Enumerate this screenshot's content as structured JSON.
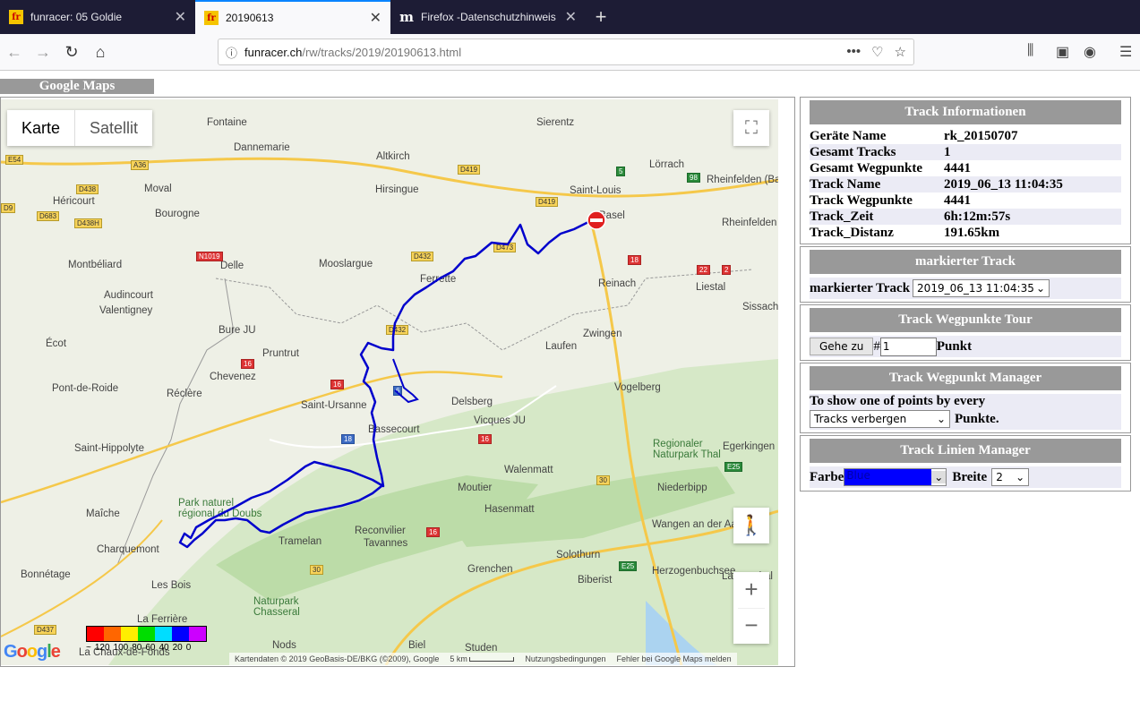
{
  "browser": {
    "tabs": [
      {
        "label": "funracer: 05 Goldie",
        "icon": "fr"
      },
      {
        "label": "20190613",
        "icon": "fr"
      },
      {
        "label": "Firefox -Datenschutzhinweis —",
        "icon": "m"
      }
    ],
    "url_host": "funracer.ch",
    "url_path": "/rw/tracks/2019/20190613.html",
    "more": "•••"
  },
  "map": {
    "header": "Google Maps",
    "type_buttons": [
      "Karte",
      "Satellit"
    ],
    "places": [
      "Fontaine",
      "Sierentz",
      "Lörrach",
      "Dannemarie",
      "Altkirch",
      "Rheinfelden (Baden)",
      "Moval",
      "Hirsingue",
      "Saint-Louis",
      "Héricourt",
      "Bourogne",
      "Basel",
      "Rheinfelden",
      "Montbéliard",
      "Delle",
      "Mooslargue",
      "Ferrette",
      "Reinach",
      "Liestal",
      "Audincourt",
      "Sissach",
      "Valentigney",
      "Bure JU",
      "Zwingen",
      "Écot",
      "Laufen",
      "Pruntrut",
      "Chevenez",
      "Vogelberg",
      "Pont-de-Roide",
      "Réclère",
      "Delsberg",
      "Saint-Ursanne",
      "Vicques JU",
      "Egerkingen",
      "Saint-Hippolyte",
      "Bassecourt",
      "Regionaler Naturpark Thal",
      "Walenmatt",
      "Moutier",
      "Niederbipp",
      "Park naturel régional du Doubs",
      "Maîche",
      "Hasenmatt",
      "Wangen an der Aare",
      "Charquemont",
      "Tramelan",
      "Reconvilier",
      "Tavannes",
      "Langenthal",
      "Solothurn",
      "Bonnétage",
      "Grenchen",
      "Herzogenbuchsee",
      "Biberist",
      "Les Bois",
      "Naturpark Chasseral",
      "La Ferrière",
      "Biel",
      "Nods",
      "Studen",
      "La Chaux-de-Fonds"
    ],
    "roads": [
      "E54",
      "A36",
      "D419",
      "5",
      "98",
      "D438",
      "D9",
      "D683",
      "D438H",
      "D419",
      "D473",
      "N1019",
      "D432",
      "18",
      "22",
      "2",
      "D432",
      "16",
      "16",
      "6",
      "18",
      "16",
      "E25",
      "30",
      "16",
      "30",
      "E25",
      "D437"
    ],
    "legend_ticks": [
      "~",
      "120",
      "100",
      "80",
      "60",
      "40",
      "20",
      "0"
    ],
    "legend_colors": [
      "#ff0000",
      "#ff6600",
      "#ffee00",
      "#00dd00",
      "#00ddff",
      "#0000ff",
      "#cc00ff"
    ],
    "google": "Google",
    "attribution": "Kartendaten © 2019 GeoBasis-DE/BKG (©2009), Google",
    "scale": "5 km",
    "terms": "Nutzungsbedingungen",
    "report": "Fehler bei Google Maps melden",
    "track_color": "#0000cc"
  },
  "info": {
    "title": "Track Informationen",
    "rows": [
      [
        "Geräte Name",
        "rk_20150707"
      ],
      [
        "Gesamt Tracks",
        "1"
      ],
      [
        "Gesamt Wegpunkte",
        "4441"
      ],
      [
        "Track Name",
        "2019_06_13 11:04:35"
      ],
      [
        "Track Wegpunkte",
        "4441"
      ],
      [
        "Track_Zeit",
        "6h:12m:57s"
      ],
      [
        "Track_Distanz",
        "191.65km"
      ]
    ]
  },
  "marked": {
    "title": "markierter Track",
    "label": "markierter Track",
    "value": "2019_06_13 11:04:35"
  },
  "tour": {
    "title": "Track Wegpunkte Tour",
    "button": "Gehe zu",
    "hash": "#",
    "value": "1",
    "suffix": "Punkt"
  },
  "wpmgr": {
    "title": "Track Wegpunkt Manager",
    "text": "To show one of points by every",
    "value": "Tracks verbergen",
    "suffix": "Punkte."
  },
  "linemgr": {
    "title": "Track Linien Manager",
    "color_label": "Farbe",
    "color_value": "Blue",
    "color_hex": "#0000ff",
    "width_label": "Breite",
    "width_value": "2"
  }
}
